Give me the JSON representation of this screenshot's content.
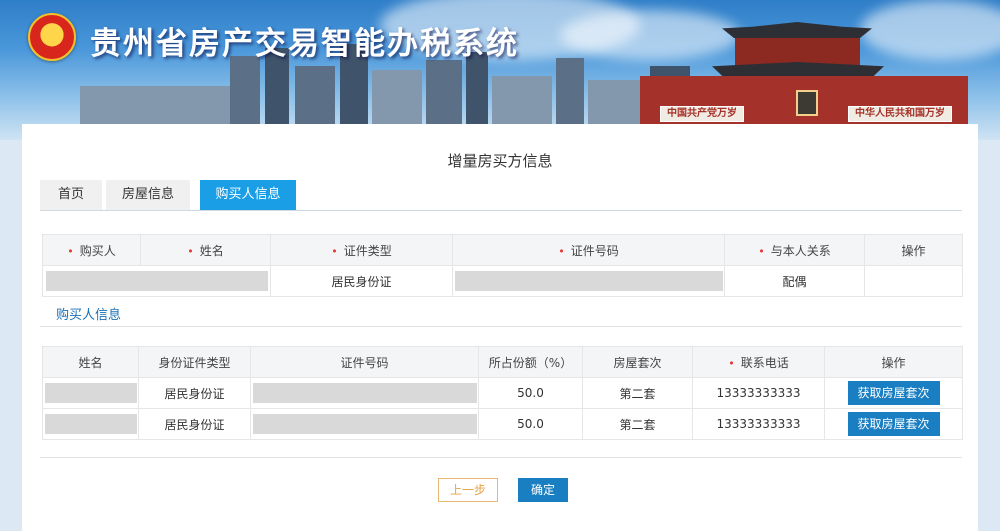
{
  "header": {
    "title": "贵州省房产交易智能办税系统",
    "wall_sign_left": "中国共产党万岁",
    "wall_sign_right": "中华人民共和国万岁"
  },
  "page": {
    "heading": "增量房买方信息"
  },
  "tabs": [
    {
      "label": "首页",
      "active": false
    },
    {
      "label": "房屋信息",
      "active": false
    },
    {
      "label": "购买人信息",
      "active": true
    }
  ],
  "buyer_table": {
    "headers": [
      {
        "label": "购买人",
        "required": true
      },
      {
        "label": "姓名",
        "required": true
      },
      {
        "label": "证件类型",
        "required": true
      },
      {
        "label": "证件号码",
        "required": true
      },
      {
        "label": "与本人关系",
        "required": true
      },
      {
        "label": "操作",
        "required": false
      }
    ],
    "rows": [
      {
        "buyer": "",
        "name": "",
        "id_type": "居民身份证",
        "id_number": "",
        "relation": "配偶",
        "action": ""
      }
    ]
  },
  "section": {
    "label": "购买人信息"
  },
  "owner_table": {
    "headers": [
      {
        "label": "姓名",
        "required": false
      },
      {
        "label": "身份证件类型",
        "required": false
      },
      {
        "label": "证件号码",
        "required": false
      },
      {
        "label": "所占份额（%）",
        "required": false
      },
      {
        "label": "房屋套次",
        "required": false
      },
      {
        "label": "联系电话",
        "required": true
      },
      {
        "label": "操作",
        "required": false
      }
    ],
    "rows": [
      {
        "name": "",
        "id_type": "居民身份证",
        "id_number": "",
        "share": "50.0",
        "house_count": "第二套",
        "phone": "13333333333",
        "action": "获取房屋套次"
      },
      {
        "name": "",
        "id_type": "居民身份证",
        "id_number": "",
        "share": "50.0",
        "house_count": "第二套",
        "phone": "13333333333",
        "action": "获取房屋套次"
      }
    ]
  },
  "footer": {
    "prev_label": "上一步",
    "confirm_label": "确定"
  },
  "colors": {
    "accent": "#1a9ee6",
    "button": "#1a7fc2",
    "required": "#e53935",
    "prev_border": "#e6b874"
  }
}
